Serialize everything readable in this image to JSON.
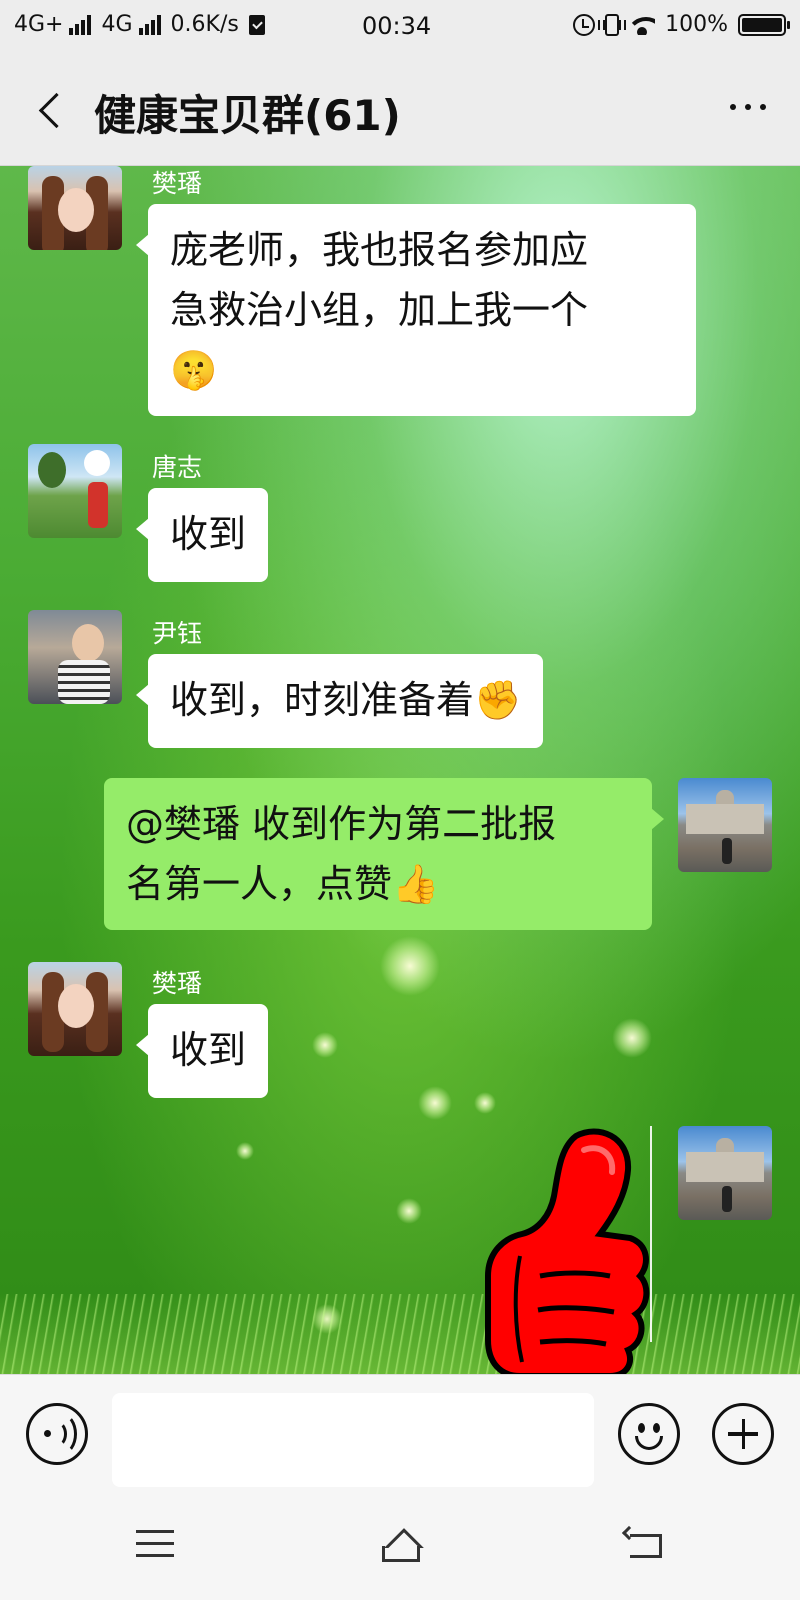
{
  "status_bar": {
    "network1": "4G+",
    "network2": "4G",
    "speed": "0.6K/s",
    "time": "00:34",
    "battery": "100%"
  },
  "header": {
    "title": "健康宝贝群(61)"
  },
  "messages": [
    {
      "side": "left",
      "sender": "樊璠",
      "text_line1": "庞老师，我也报名参加应",
      "text_line2": "急救治小组，加上我一个",
      "emoji": "🤫"
    },
    {
      "side": "left",
      "sender": "唐志",
      "text": "收到"
    },
    {
      "side": "left",
      "sender": "尹钰",
      "text": "收到，时刻准备着✊"
    },
    {
      "side": "right",
      "text_line1": "@樊璠  收到作为第二批报",
      "text_line2": "名第一人，点赞👍"
    },
    {
      "side": "left",
      "sender": "樊璠",
      "text": "收到"
    },
    {
      "side": "right",
      "sticker": "thumbs-up-sticker"
    }
  ],
  "input": {
    "value": "",
    "placeholder": ""
  },
  "colors": {
    "bubble_incoming": "#ffffff",
    "bubble_outgoing": "#95ec69",
    "sticker_red": "#ff0000"
  },
  "icons": [
    "back-icon",
    "more-icon",
    "voice-icon",
    "emoji-icon",
    "plus-icon",
    "menu-icon",
    "home-icon",
    "return-icon"
  ]
}
